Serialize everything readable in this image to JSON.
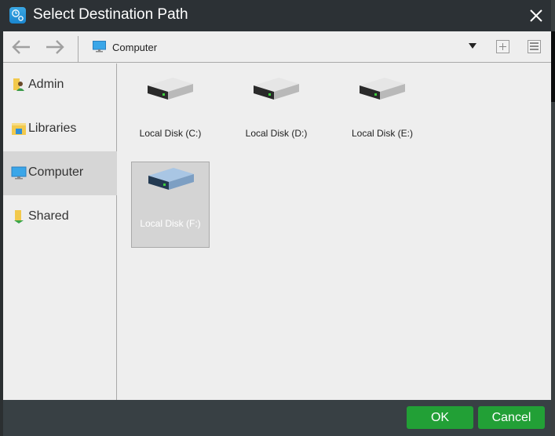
{
  "window": {
    "title": "Select Destination Path",
    "app_icon": "backup-app-icon",
    "close_icon": "close-icon"
  },
  "toolbar": {
    "back_icon": "arrow-left-icon",
    "forward_icon": "arrow-right-icon",
    "location_icon": "computer-monitor-icon",
    "location": "Computer",
    "dropdown_icon": "caret-down-icon",
    "new_folder_icon": "plus-box-icon",
    "view_icon": "list-view-icon"
  },
  "sidebar": {
    "items": [
      {
        "label": "Admin",
        "icon": "user-folder-icon",
        "selected": false
      },
      {
        "label": "Libraries",
        "icon": "libraries-folder-icon",
        "selected": false
      },
      {
        "label": "Computer",
        "icon": "computer-monitor-icon",
        "selected": true
      },
      {
        "label": "Shared",
        "icon": "shared-folder-icon",
        "selected": false
      }
    ]
  },
  "content": {
    "drives": [
      {
        "label": "Local Disk (C:)",
        "icon": "hard-drive-icon",
        "selected": false
      },
      {
        "label": "Local Disk (D:)",
        "icon": "hard-drive-icon",
        "selected": false
      },
      {
        "label": "Local Disk (E:)",
        "icon": "hard-drive-icon",
        "selected": false
      },
      {
        "label": "Local Disk (F:)",
        "icon": "hard-drive-icon",
        "selected": true
      }
    ]
  },
  "footer": {
    "ok_label": "OK",
    "cancel_label": "Cancel"
  },
  "colors": {
    "titlebar": "#2c3135",
    "footer": "#384044",
    "button_green": "#22a036",
    "selected_bg": "#d6d6d6",
    "panel_bg": "#eeeeee"
  }
}
